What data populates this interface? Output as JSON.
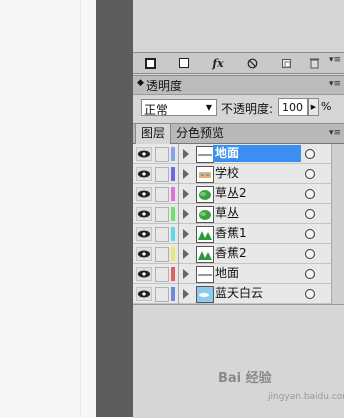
{
  "toolbar": {
    "buttons": [
      {
        "name": "mask-square-icon"
      },
      {
        "name": "new-square-icon"
      },
      {
        "label": "fx"
      },
      {
        "name": "no-entry-icon"
      },
      {
        "name": "new-layer-icon"
      },
      {
        "name": "trash-icon"
      }
    ]
  },
  "transparency": {
    "title": "透明度",
    "blend_mode": "正常",
    "opacity_label": "不透明度:",
    "opacity_value": "100",
    "opacity_unit": "%"
  },
  "tabs": [
    {
      "label": "图层",
      "active": true
    },
    {
      "label": "分色预览",
      "active": false
    }
  ],
  "layers": [
    {
      "name": "地面",
      "color": "#8aa0f0",
      "selected": true,
      "thumb": "line"
    },
    {
      "name": "学校",
      "color": "#6a6ae0",
      "selected": false,
      "thumb": "school"
    },
    {
      "name": "草丛2",
      "color": "#e070e0",
      "selected": false,
      "thumb": "grass"
    },
    {
      "name": "草丛",
      "color": "#70e070",
      "selected": false,
      "thumb": "grass"
    },
    {
      "name": "香蕉1",
      "color": "#60d8e8",
      "selected": false,
      "thumb": "banana"
    },
    {
      "name": "香蕉2",
      "color": "#e8e870",
      "selected": false,
      "thumb": "banana"
    },
    {
      "name": "地面",
      "color": "#e06060",
      "selected": false,
      "thumb": "line"
    },
    {
      "name": "蓝天白云",
      "color": "#6a8ae0",
      "selected": false,
      "thumb": "sky"
    }
  ],
  "watermark": {
    "main": "Bai 经验",
    "sub": "jingyan.baidu.com"
  }
}
